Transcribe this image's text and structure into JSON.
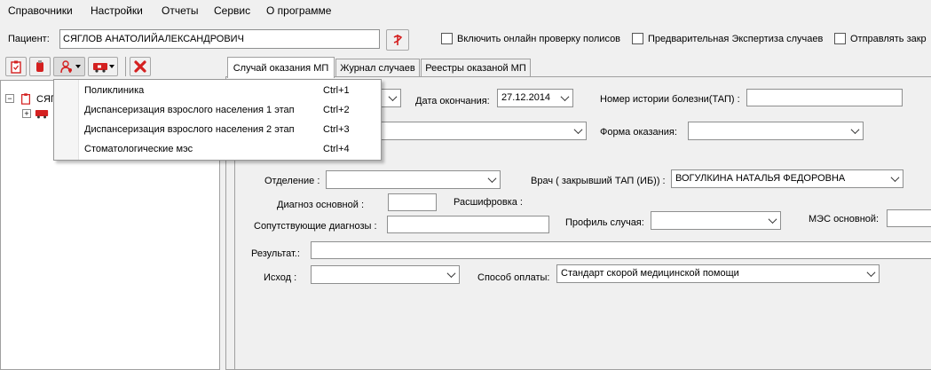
{
  "menubar": {
    "items": [
      "Справочники",
      "Настройки",
      "Отчеты",
      "Сервис",
      "О программе"
    ]
  },
  "patient": {
    "label": "Пациент:",
    "value": "СЯГЛОВ АНАТОЛИЙАЛЕКСАНДРОВИЧ"
  },
  "options": {
    "online_check": "Включить онлайн проверку полисов",
    "pre_expertise": "Предварительная Экспертиза случаев",
    "send": "Отправлять закр"
  },
  "tabs": [
    {
      "label": "Случай оказания МП"
    },
    {
      "label": "Журнал случаев"
    },
    {
      "label": "Реестры оказаной МП"
    }
  ],
  "tree": {
    "root_label": "СЯГ"
  },
  "dropdown": {
    "items": [
      {
        "label": "Поликлиника",
        "shortcut": "Ctrl+1"
      },
      {
        "label": "Диспансеризация взрослого населения 1 этап",
        "shortcut": "Ctrl+2"
      },
      {
        "label": "Диспансеризация взрослого населения 2 этап",
        "shortcut": "Ctrl+3"
      },
      {
        "label": "Стоматологические мэс",
        "shortcut": "Ctrl+4"
      }
    ]
  },
  "form": {
    "end_date_label": "Дата окончания:",
    "end_date_value": "27.12.2014",
    "history_label": "Номер истории болезни(ТАП) :",
    "form_label": "Форма оказания:",
    "department_label": "Отделение :",
    "doctor_label": "Врач ( закрывший ТАП (ИБ)) :",
    "doctor_value": "ВОГУЛКИНА НАТАЛЬЯ ФЕДОРОВНА",
    "main_diag_label": "Диагноз основной :",
    "decode_label": "Расшифровка :",
    "concomitant_label": "Сопутствующие диагнозы :",
    "profile_label": "Профиль случая:",
    "mes_label": "МЭС основной:",
    "result_label": "Результат.:",
    "outcome_label": "Исход  :",
    "payment_label": "Способ оплаты:",
    "payment_value": "Стандарт скорой медицинской помощи"
  },
  "colors": {
    "accent_red": "#d42020",
    "window_bg": "#f0f0f0"
  }
}
